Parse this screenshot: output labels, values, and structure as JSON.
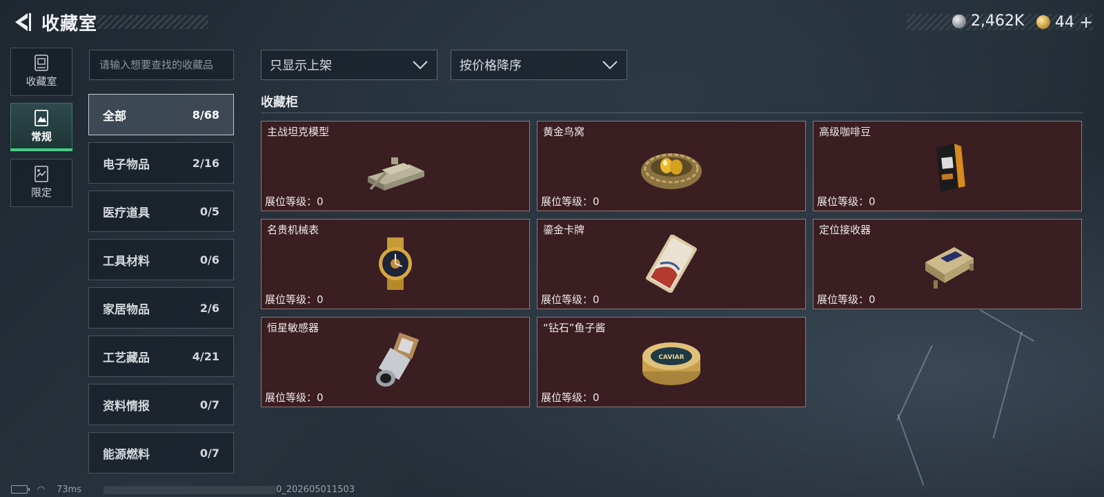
{
  "header": {
    "title": "收藏室",
    "currency_silver": "2,462K",
    "currency_gold": "44",
    "currency_gold_plus": "+"
  },
  "nav": [
    {
      "label": "收藏室",
      "icon": "collection-box-icon",
      "active": false
    },
    {
      "label": "常规",
      "icon": "photo-card-icon",
      "active": true
    },
    {
      "label": "限定",
      "icon": "limited-card-icon",
      "active": false
    }
  ],
  "search": {
    "placeholder": "请输入想要查找的收藏品"
  },
  "categories": [
    {
      "name": "全部",
      "count": "8/68",
      "active": true
    },
    {
      "name": "电子物品",
      "count": "2/16"
    },
    {
      "name": "医疗道具",
      "count": "0/5"
    },
    {
      "name": "工具材料",
      "count": "0/6"
    },
    {
      "name": "家居物品",
      "count": "2/6"
    },
    {
      "name": "工艺藏品",
      "count": "4/21"
    },
    {
      "name": "资料情报",
      "count": "0/7"
    },
    {
      "name": "能源燃料",
      "count": "0/7"
    }
  ],
  "filters": {
    "show_filter": "只显示上架",
    "sort": "按价格降序"
  },
  "cabinet": {
    "title": "收藏柜",
    "items": [
      {
        "name": "主战坦克模型",
        "level_label": "展位等级：",
        "level": "0",
        "icon": "tank-model-icon"
      },
      {
        "name": "黄金鸟窝",
        "level_label": "展位等级：",
        "level": "0",
        "icon": "golden-nest-icon"
      },
      {
        "name": "高级咖啡豆",
        "level_label": "展位等级：",
        "level": "0",
        "icon": "coffee-bag-icon"
      },
      {
        "name": "名贵机械表",
        "level_label": "展位等级：",
        "level": "0",
        "icon": "gold-watch-icon"
      },
      {
        "name": "鎏金卡牌",
        "level_label": "展位等级：",
        "level": "0",
        "icon": "gilded-card-icon"
      },
      {
        "name": "定位接收器",
        "level_label": "展位等级：",
        "level": "0",
        "icon": "gps-receiver-icon"
      },
      {
        "name": "恒星敏感器",
        "level_label": "展位等级：",
        "level": "0",
        "icon": "star-sensor-icon"
      },
      {
        "name": "“钻石”鱼子酱",
        "level_label": "展位等级：",
        "level": "0",
        "icon": "caviar-tin-icon",
        "tin_text": "CAVIAR"
      }
    ]
  },
  "status": {
    "ping": "73ms",
    "build": "0_202605011503"
  },
  "colors": {
    "accent": "#3fd08b",
    "card_bg": "#3a1e22"
  }
}
